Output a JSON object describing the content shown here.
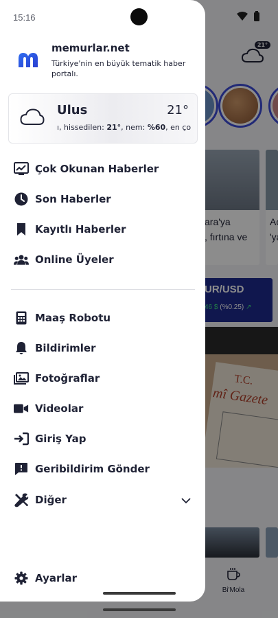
{
  "status_bar": {
    "time": "15:16"
  },
  "header": {
    "site_name": "memurlar.net",
    "site_description": "Türkiye'nin en büyük tematik haber portalı."
  },
  "weather": {
    "city": "Ulus",
    "temperature": "21°",
    "detail_prefix": "ı, hissedilen: ",
    "feels_like": "21°",
    "detail_mid": ", nem: ",
    "humidity": "%60",
    "detail_suffix": ", en ço"
  },
  "menu": {
    "primary": [
      {
        "label": "Çok Okunan Haberler",
        "icon": "trending-chart-icon"
      },
      {
        "label": "Son Haberler",
        "icon": "clock-icon"
      },
      {
        "label": "Kayıtlı Haberler",
        "icon": "bookmark-icon"
      },
      {
        "label": "Online Üyeler",
        "icon": "users-icon"
      }
    ],
    "secondary": [
      {
        "label": "Maaş Robotu",
        "icon": "calculator-icon"
      },
      {
        "label": "Bildirimler",
        "icon": "bell-icon"
      },
      {
        "label": "Fotoğraflar",
        "icon": "images-icon"
      },
      {
        "label": "Videolar",
        "icon": "video-camera-icon"
      },
      {
        "label": "Giriş Yap",
        "icon": "login-icon"
      },
      {
        "label": "Geribildirim Gönder",
        "icon": "feedback-icon"
      },
      {
        "label": "Diğer",
        "icon": "tools-icon"
      }
    ],
    "settings_label": "Ayarlar"
  },
  "background": {
    "weather_badge": "21°",
    "news_text_1": "ara'ya\n, fırtına ve",
    "news_text_2": "Aç\n'ya",
    "fx_title": "UR/USD",
    "fx_value": "46 $",
    "fx_change": " (%0.25)",
    "gazete_tc": "T.C.",
    "gazete_title": "mî Gazete",
    "bottom_tab_label": "Bi'Mola"
  },
  "colors": {
    "brand_blue": "#3c4bd8",
    "text_dark": "#1f2235",
    "fx_bg": "#1e2a8f",
    "fx_up": "#3fe083"
  }
}
